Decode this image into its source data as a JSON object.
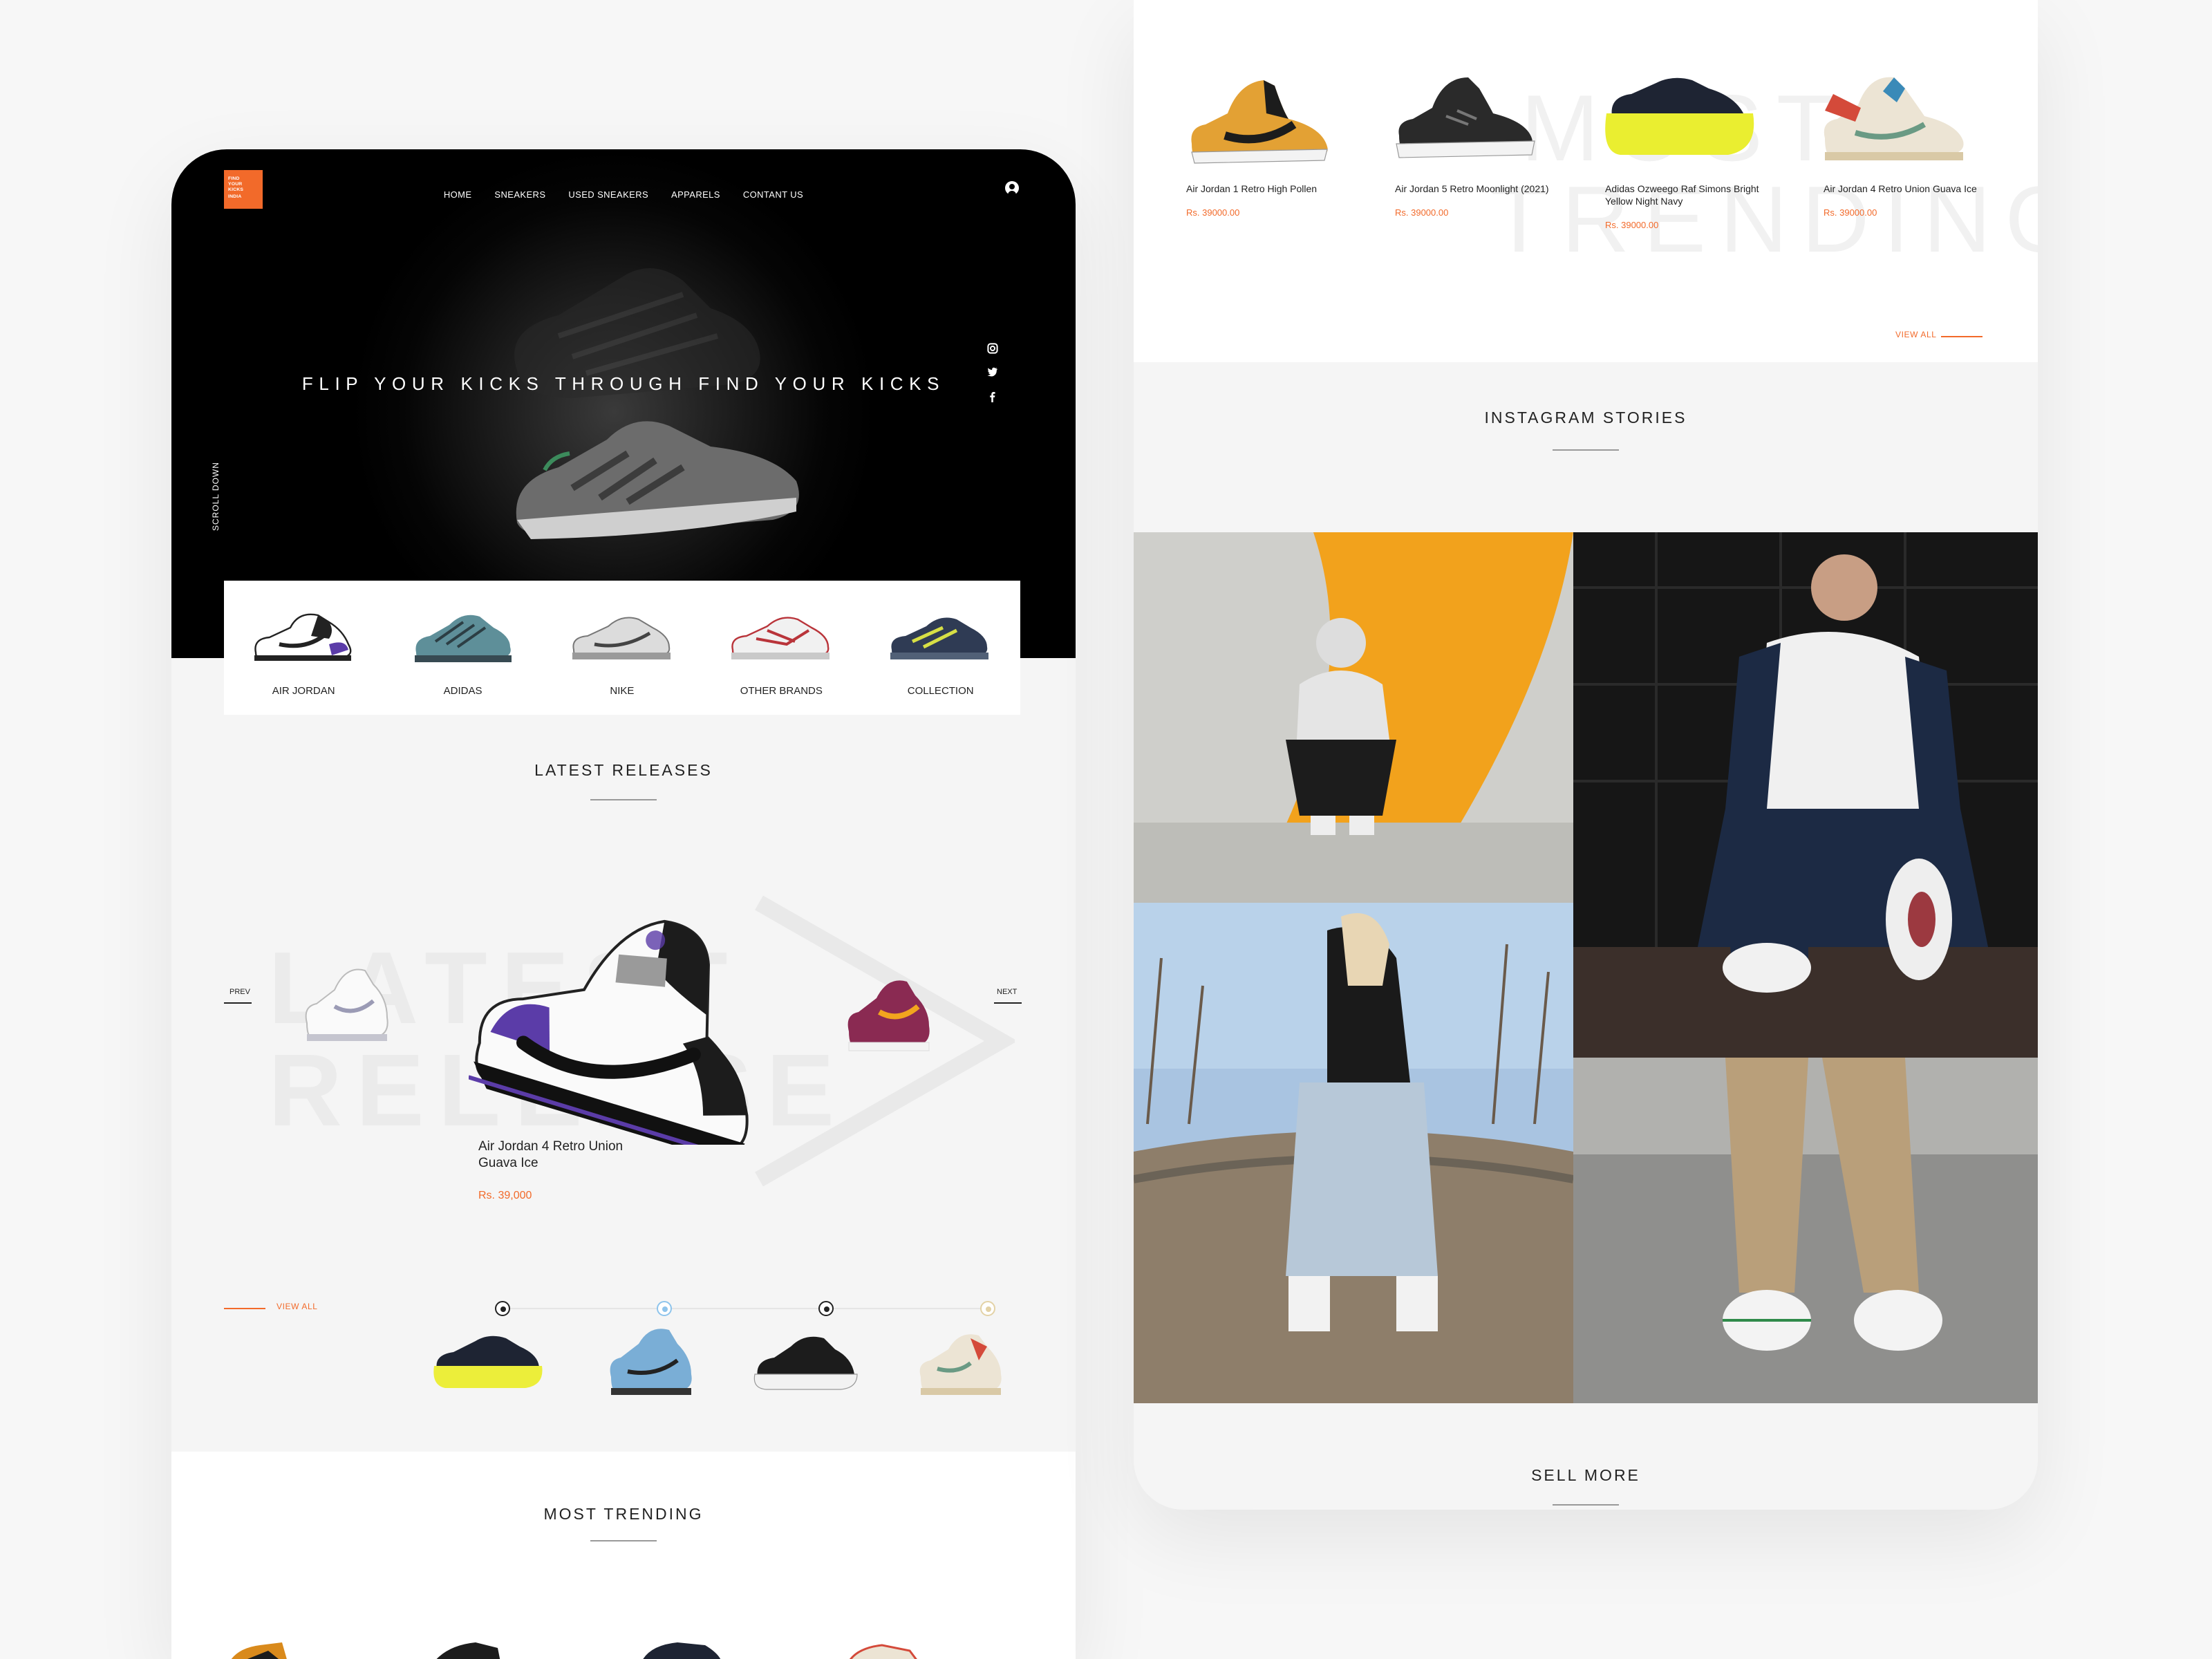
{
  "brand": {
    "logo_lines": [
      "FIND",
      "YOUR",
      "KICKS",
      "INDIA"
    ],
    "accent_color": "#f26a2a"
  },
  "nav": {
    "items": [
      "HOME",
      "SNEAKERS",
      "USED SNEAKERS",
      "APPARELS",
      "CONTANT US"
    ],
    "user_icon": "user-circle-icon"
  },
  "hero": {
    "title": "FLIP YOUR KICKS THROUGH FIND YOUR KICKS",
    "scroll_label": "SCROLL DOWN",
    "social_icons": [
      "instagram-icon",
      "twitter-icon",
      "facebook-icon"
    ]
  },
  "categories": [
    "AIR JORDAN",
    "ADIDAS",
    "NIKE",
    "OTHER BRANDS",
    "COLLECTION"
  ],
  "latest_releases": {
    "title": "LATEST RELEASES",
    "watermark": [
      "LATEST",
      "RELEASE"
    ],
    "prev_label": "PREV",
    "next_label": "NEXT",
    "featured_name": "Air Jordan 4 Retro Union Guava Ice",
    "featured_price": "Rs. 39,000",
    "view_all": "VIEW ALL",
    "thumb_dot_colors": [
      "#222222",
      "#8ec4ec",
      "#222222",
      "#e3d2a6"
    ]
  },
  "most_trending": {
    "title": "MOST TRENDING",
    "watermark": [
      "MOST",
      "TRENDING"
    ],
    "view_all": "VIEW ALL",
    "products": [
      {
        "name": "Air Jordan 1 Retro High Pollen",
        "price": "Rs. 39000.00"
      },
      {
        "name": "Air Jordan 5 Retro Moonlight (2021)",
        "price": "Rs. 39000.00"
      },
      {
        "name": "Adidas Ozweego Raf Simons Bright Yellow Night Navy",
        "price": "Rs. 39000.00"
      },
      {
        "name": "Air Jordan 4 Retro Union Guava Ice",
        "price": "Rs. 39000.00"
      }
    ]
  },
  "instagram": {
    "title": "INSTAGRAM STORIES"
  },
  "sell_more": {
    "title": "SELL MORE"
  }
}
